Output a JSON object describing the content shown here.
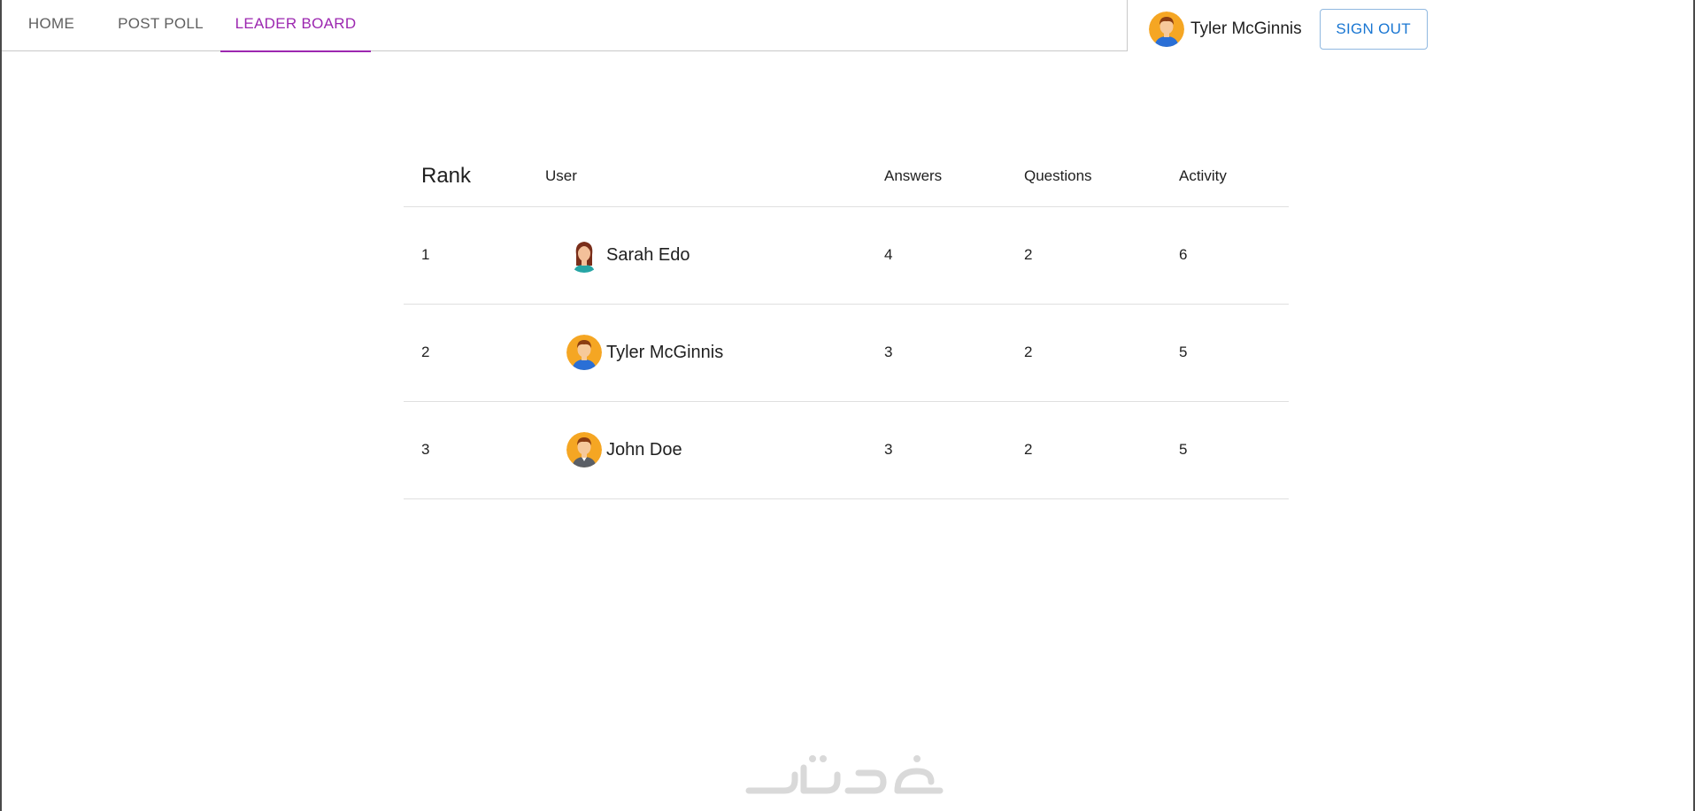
{
  "nav": {
    "tabs": [
      {
        "label": "HOME"
      },
      {
        "label": "POST POLL"
      },
      {
        "label": "LEADER BOARD"
      }
    ],
    "active_color": "#9c27b0"
  },
  "user": {
    "name": "Tyler McGinnis",
    "avatar_icon": "man-avatar-icon",
    "sign_out_label": "SIGN OUT"
  },
  "leaderboard": {
    "headers": {
      "rank": "Rank",
      "user": "User",
      "answers": "Answers",
      "questions": "Questions",
      "activity": "Activity"
    },
    "rows": [
      {
        "rank": "1",
        "name": "Sarah Edo",
        "avatar_icon": "woman-avatar-icon",
        "answers": "4",
        "questions": "2",
        "activity": "6"
      },
      {
        "rank": "2",
        "name": "Tyler McGinnis",
        "avatar_icon": "man-avatar-icon",
        "answers": "3",
        "questions": "2",
        "activity": "5"
      },
      {
        "rank": "3",
        "name": "John Doe",
        "avatar_icon": "man-gray-shirt-avatar-icon",
        "answers": "3",
        "questions": "2",
        "activity": "5"
      }
    ]
  },
  "colors": {
    "accent": "#9c27b0",
    "button": "#1976d2"
  }
}
